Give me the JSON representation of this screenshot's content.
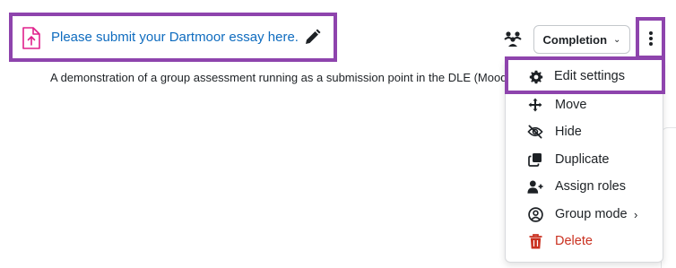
{
  "activity": {
    "title": "Please submit your Dartmoor essay here.",
    "description": "A demonstration of a group assessment running as a submission point in the DLE (Moodle)"
  },
  "completion": {
    "label": "Completion"
  },
  "menu": {
    "items": [
      {
        "label": "Edit settings",
        "icon": "gear-icon"
      },
      {
        "label": "Move",
        "icon": "move-arrows-icon"
      },
      {
        "label": "Hide",
        "icon": "eye-slash-icon"
      },
      {
        "label": "Duplicate",
        "icon": "duplicate-icon"
      },
      {
        "label": "Assign roles",
        "icon": "user-plus-icon"
      },
      {
        "label": "Group mode",
        "icon": "group-circle-icon"
      },
      {
        "label": "Delete",
        "icon": "trash-icon"
      }
    ]
  },
  "colors": {
    "highlight": "#8e44ad",
    "link": "#0f6cbf",
    "file_icon": "#e0208c",
    "danger": "#ca3120"
  }
}
